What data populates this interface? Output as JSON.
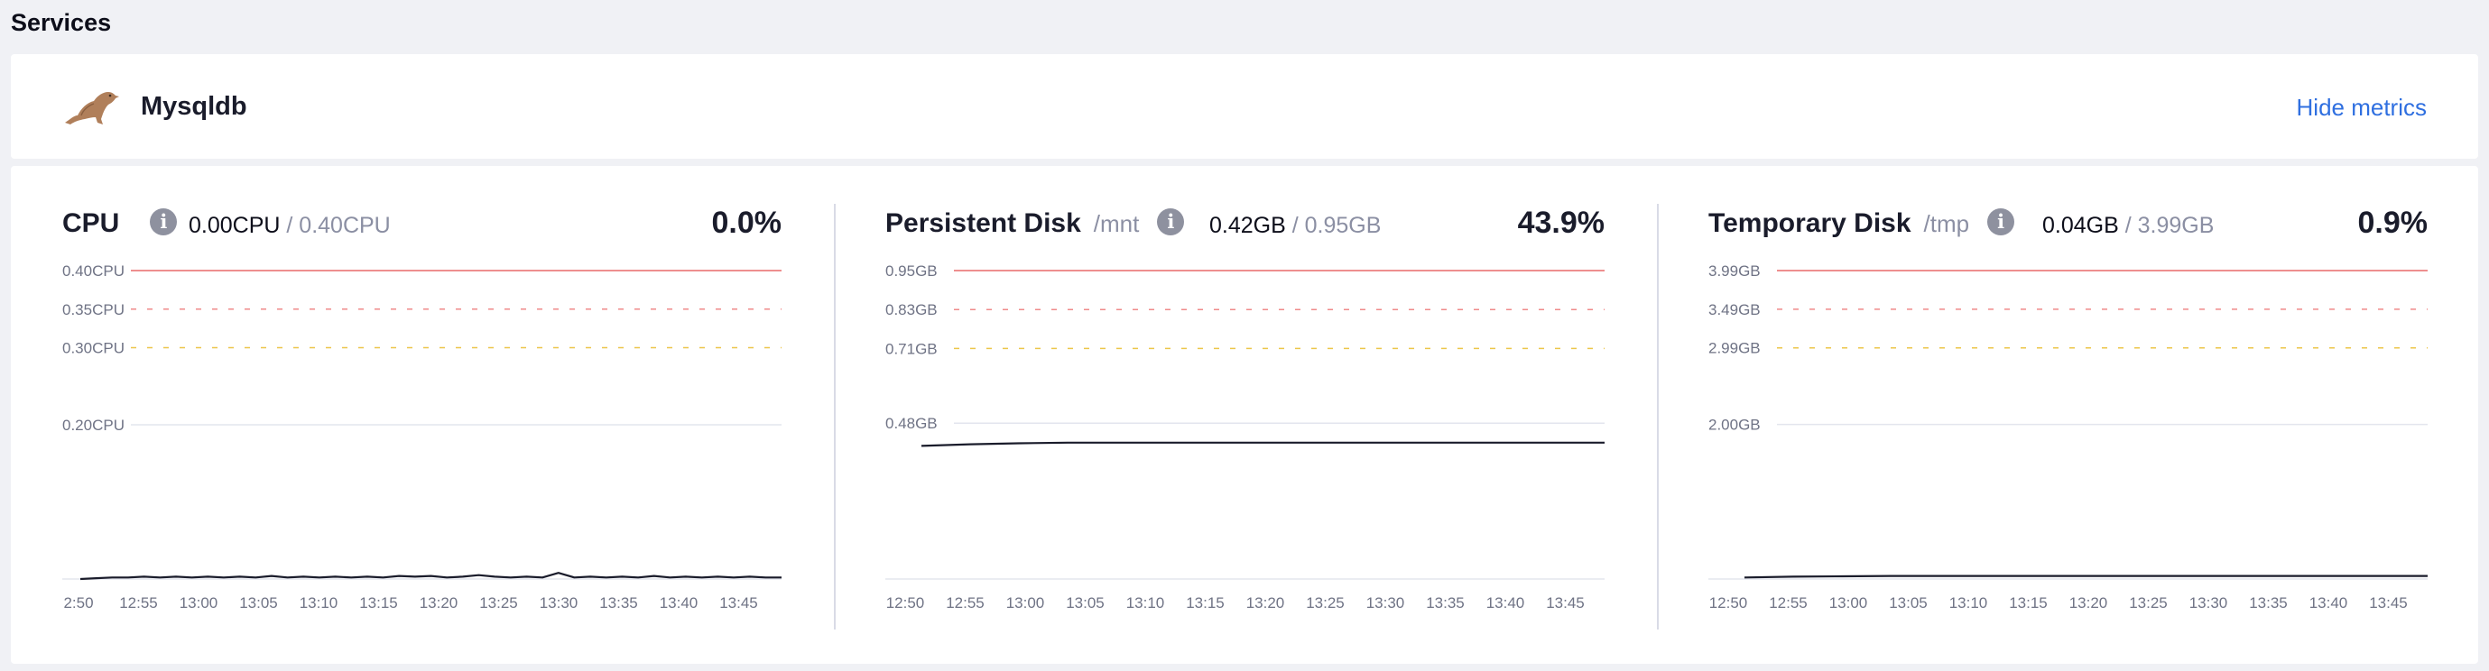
{
  "section_title": "Services",
  "service": {
    "name": "Mysqldb",
    "logo_icon": "mariadb-seal-icon",
    "hide_metrics_label": "Hide metrics"
  },
  "colors": {
    "limit_line": "#e86a6a",
    "danger_dash": "#ef8a8a",
    "warn_dash": "#ecc64a",
    "grid": "#e3e5ee",
    "series": "#1a1c2b",
    "link": "#2f6fe0"
  },
  "metrics": [
    {
      "title": "CPU",
      "path": "",
      "current": "0.00CPU",
      "limit": "/ 0.40CPU",
      "percent": "0.0%",
      "chart_data": {
        "type": "line",
        "y_ticks": [
          "0.40CPU",
          "0.35CPU",
          "0.30CPU",
          "0.20CPU"
        ],
        "y_tick_values": [
          0.4,
          0.35,
          0.3,
          0.2
        ],
        "ylim": [
          0,
          0.4
        ],
        "x_ticks": [
          "2:50",
          "12:55",
          "13:00",
          "13:05",
          "13:10",
          "13:15",
          "13:20",
          "13:25",
          "13:30",
          "13:35",
          "13:40",
          "13:45"
        ],
        "series": [
          {
            "values": [
              0.0,
              0.001,
              0.002,
              0.002,
              0.003,
              0.002,
              0.003,
              0.002,
              0.003,
              0.002,
              0.003,
              0.002,
              0.004,
              0.002,
              0.003,
              0.002,
              0.003,
              0.002,
              0.003,
              0.002,
              0.004,
              0.003,
              0.004,
              0.002,
              0.003,
              0.005,
              0.003,
              0.002,
              0.003,
              0.002,
              0.008,
              0.002,
              0.003,
              0.002,
              0.003,
              0.002,
              0.004,
              0.002,
              0.003,
              0.002,
              0.003,
              0.002,
              0.003,
              0.002,
              0.002
            ]
          }
        ]
      }
    },
    {
      "title": "Persistent Disk",
      "path": "/mnt",
      "current": "0.42GB",
      "limit": "/ 0.95GB",
      "percent": "43.9%",
      "chart_data": {
        "type": "line",
        "y_ticks": [
          "0.95GB",
          "0.83GB",
          "0.71GB",
          "0.48GB"
        ],
        "y_tick_values": [
          0.95,
          0.83,
          0.71,
          0.48
        ],
        "ylim": [
          0,
          0.95
        ],
        "x_ticks": [
          "12:50",
          "12:55",
          "13:00",
          "13:05",
          "13:10",
          "13:15",
          "13:20",
          "13:25",
          "13:30",
          "13:35",
          "13:40",
          "13:45"
        ],
        "series": [
          {
            "values": [
              0.41,
              0.415,
              0.418,
              0.42,
              0.42,
              0.42,
              0.42,
              0.42,
              0.42,
              0.42,
              0.42,
              0.42,
              0.42,
              0.42,
              0.42
            ]
          }
        ]
      }
    },
    {
      "title": "Temporary Disk",
      "path": "/tmp",
      "current": "0.04GB",
      "limit": "/ 3.99GB",
      "percent": "0.9%",
      "chart_data": {
        "type": "line",
        "y_ticks": [
          "3.99GB",
          "3.49GB",
          "2.99GB",
          "2.00GB"
        ],
        "y_tick_values": [
          3.99,
          3.49,
          2.99,
          2.0
        ],
        "ylim": [
          0,
          3.99
        ],
        "x_ticks": [
          "12:50",
          "12:55",
          "13:00",
          "13:05",
          "13:10",
          "13:15",
          "13:20",
          "13:25",
          "13:30",
          "13:35",
          "13:40",
          "13:45"
        ],
        "series": [
          {
            "values": [
              0.02,
              0.03,
              0.035,
              0.04,
              0.04,
              0.04,
              0.04,
              0.04,
              0.04,
              0.04,
              0.04,
              0.04,
              0.04,
              0.04,
              0.04
            ]
          }
        ]
      }
    }
  ]
}
